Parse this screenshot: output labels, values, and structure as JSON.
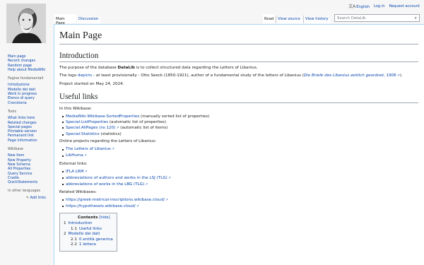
{
  "personal": {
    "language": "English",
    "login": "Log in",
    "request": "Request account"
  },
  "tabs": {
    "main_page": "Main Page",
    "discussion": "Discussion",
    "read": "Read",
    "view_source": "View source",
    "view_history": "View history"
  },
  "search": {
    "placeholder": "Search DataLib"
  },
  "sidebar": {
    "nav": [
      "Main page",
      "Recent changes",
      "Random page",
      "Help about MediaWiki"
    ],
    "pagine_heading": "Pagine fondamentali",
    "pagine": [
      "Introduzione",
      "Modello dei dati",
      "Work in progress",
      "Elenco di query",
      "Cronistoria"
    ],
    "tools_heading": "Tools",
    "tools": [
      "What links here",
      "Related changes",
      "Special pages",
      "Printable version",
      "Permanent link",
      "Page information"
    ],
    "wikibase_heading": "Wikibase",
    "wikibase": [
      "New Item",
      "New Property",
      "New Schema",
      "All Properties",
      "Query Service",
      "Cradle",
      "QuickStatements"
    ],
    "languages_heading": "In other languages",
    "add_links": "Add links"
  },
  "page": {
    "title": "Main Page",
    "intro_heading": "Introduction",
    "intro_p1_pre": "The purpose of the database ",
    "intro_p1_bold": "DataLib",
    "intro_p1_post": " is to collect structured data regarding the Letters of Libanius.",
    "intro_p2_pre": "The logo ",
    "intro_p2_link": "depicts",
    "intro_p2_mid": " - at least provisionally - Otto Seeck (1850-1921), author of a fundamental study of the letters of Libanius (",
    "intro_p2_book": "Die Briefe des Libanius zeitlich geordnet",
    "intro_p2_year": ", 1906",
    "intro_p2_end": ").",
    "intro_p3": "Project started on May 24, 2024.",
    "useful_heading": "Useful links",
    "in_wikibase": "In this Wikibase:",
    "wb_links": [
      {
        "link": "MediaWiki:Wikibase-SortedProperties",
        "note": " (manually sorted list of properties)"
      },
      {
        "link": "Special:ListProperties",
        "note": " (automatic list of properties)"
      },
      {
        "link": "Special:AllPages (ns 120)",
        "note": " (automatic list of items)"
      },
      {
        "link": "Special:Statistics",
        "note": " (statistics)"
      }
    ],
    "online_projects": "Online projects regarding the Letters of Libanius:",
    "projects": [
      "The Letters of Libanius",
      "LibHuma"
    ],
    "external_label": "External links:",
    "external": [
      "IFLA LRM",
      "abbreviations of authors and works in the LSJ (TLG)",
      "abbreviations of works in the LBG (TLG)"
    ],
    "related_label": "Related Wikibases:",
    "related": [
      "https://greek-metrical-inscriptions.wikibase.cloud/",
      "https://hypotheseis.wikibase.cloud/"
    ]
  },
  "toc": {
    "title": "Contents",
    "hide": "[hide]",
    "entries": [
      {
        "num": "1",
        "label": "Introduction"
      },
      {
        "num": "1.1",
        "label": "Useful links"
      },
      {
        "num": "2",
        "label": "Modello dei dati"
      },
      {
        "num": "2.1",
        "label": "0 entità generica"
      },
      {
        "num": "2.2",
        "label": "1 lettera"
      }
    ]
  },
  "colors": {
    "link": "#0645ad",
    "border": "#a7d7f9"
  },
  "icons": [
    "translate-icon",
    "search-icon",
    "external-link-icon",
    "pencil-icon"
  ]
}
